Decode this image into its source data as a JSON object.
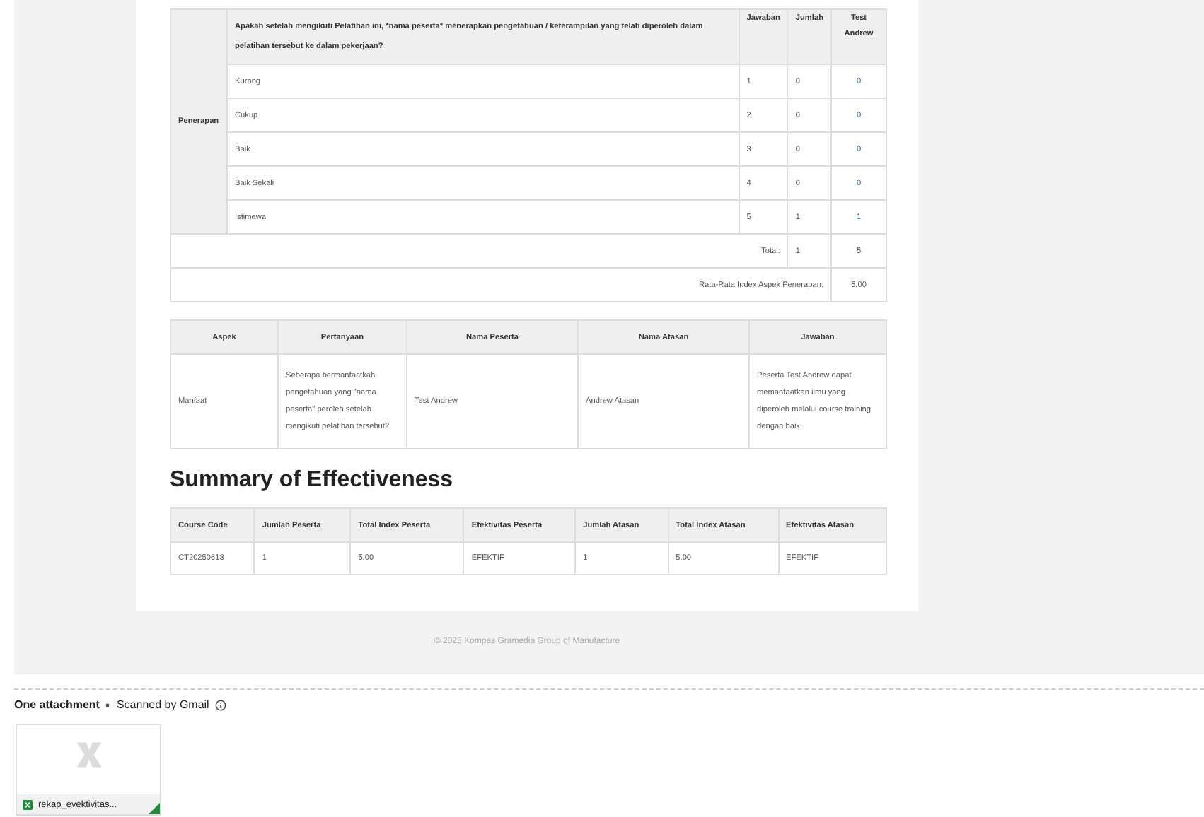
{
  "penilaian": {
    "aspect": "Penerapan",
    "question": "Apakah setelah mengikuti Pelatihan ini, *nama peserta* menerapkan pengetahuan / keterampilan yang telah diperoleh dalam pelatihan tersebut ke dalam pekerjaan?",
    "column_headers": [
      "Jawaban",
      "Jumlah",
      "Test Andrew"
    ],
    "rows": [
      {
        "label": "Kurang",
        "jawaban": "1",
        "jumlah": "0",
        "score": "0"
      },
      {
        "label": "Cukup",
        "jawaban": "2",
        "jumlah": "0",
        "score": "0"
      },
      {
        "label": "Baik",
        "jawaban": "3",
        "jumlah": "0",
        "score": "0"
      },
      {
        "label": "Baik Sekali",
        "jawaban": "4",
        "jumlah": "0",
        "score": "0"
      },
      {
        "label": "Istimewa",
        "jawaban": "5",
        "jumlah": "1",
        "score": "1"
      }
    ],
    "total_label": "Total:",
    "total_jumlah": "1",
    "total_score": "5",
    "average_label": "Rata-Rata Index Aspek Penerapan:",
    "average_value": "5.00"
  },
  "manfaat_table": {
    "columns": [
      "Aspek",
      "Pertanyaan",
      "Nama Peserta",
      "Nama Atasan",
      "Jawaban"
    ],
    "rows": [
      [
        "Manfaat",
        "Seberapa bermanfaatkah pengetahuan yang \"nama peserta\" peroleh setelah mengikuti pelatihan tersebut?",
        "Test Andrew",
        "Andrew Atasan",
        "Peserta Test Andrew dapat memanfaatkan ilmu yang diperoleh melalui course training dengan baik."
      ]
    ]
  },
  "summary": {
    "title": "Summary of Effectiveness",
    "columns": [
      "Course Code",
      "Jumlah Peserta",
      "Total Index Peserta",
      "Efektivitas Peserta",
      "Jumlah Atasan",
      "Total Index Atasan",
      "Efektivitas Atasan"
    ],
    "rows": [
      [
        "CT20250613",
        "1",
        "5.00",
        "EFEKTIF",
        "1",
        "5.00",
        "EFEKTIF"
      ]
    ]
  },
  "footer": "© 2025 Kompas Gramedia Group of Manufacture",
  "attachments": {
    "heading": "One attachment",
    "scan_note": "Scanned by Gmail",
    "files": [
      {
        "name": "rekap_evektivitas..."
      }
    ]
  }
}
